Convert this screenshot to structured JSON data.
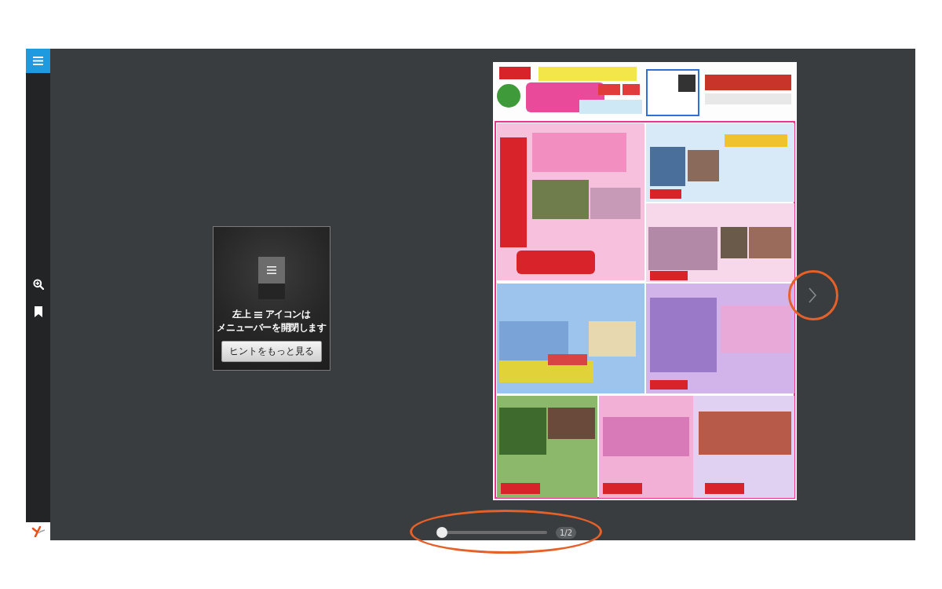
{
  "sidebar": {
    "tools": [
      {
        "kind": "zoom"
      },
      {
        "kind": "bookmark"
      }
    ]
  },
  "hint_popup": {
    "text_before_icon": "左上",
    "text_after_icon": "アイコンは",
    "text_line_2": "メニューバーを開閉します",
    "button": "ヒントをもっと見る"
  },
  "viewer": {
    "next_button": {
      "highlighted": true
    },
    "page_slider": {
      "level": 0,
      "highlighted": true
    },
    "page_indicator": "1/2"
  }
}
